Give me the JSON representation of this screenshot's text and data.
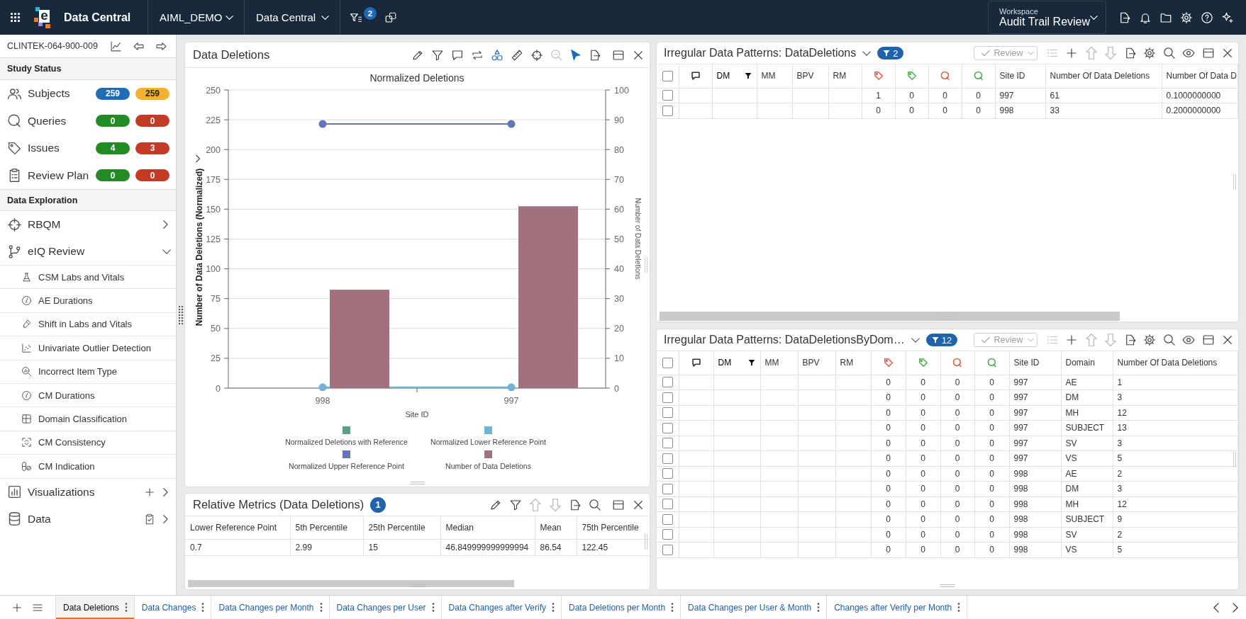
{
  "top_bar": {
    "logo_mark": "e",
    "app_name": "Data Central",
    "selectors": [
      {
        "label": "AIML_DEMO"
      },
      {
        "label": "Data Central"
      }
    ],
    "filter_count": "2",
    "workspace": {
      "caption": "Workspace",
      "value": "Audit Trail Review"
    }
  },
  "sidebar": {
    "study_id": "CLINTEK-064-900-009",
    "study_status": {
      "title": "Study Status",
      "items": [
        {
          "label": "Subjects",
          "badges": [
            {
              "value": "259",
              "color": "#1f6cb5"
            },
            {
              "value": "259",
              "color": "#f2b22e"
            }
          ]
        },
        {
          "label": "Queries",
          "badges": [
            {
              "value": "0",
              "color": "#238b23"
            },
            {
              "value": "0",
              "color": "#c33b25"
            }
          ]
        },
        {
          "label": "Issues",
          "badges": [
            {
              "value": "4",
              "color": "#238b23"
            },
            {
              "value": "3",
              "color": "#c33b25"
            }
          ]
        },
        {
          "label": "Review Plan",
          "badges": [
            {
              "value": "0",
              "color": "#238b23"
            },
            {
              "value": "0",
              "color": "#c33b25"
            }
          ]
        }
      ]
    },
    "data_exploration": {
      "title": "Data Exploration",
      "items": [
        {
          "label": "RBQM",
          "expanded": false
        },
        {
          "label": "eIQ Review",
          "expanded": true,
          "children": [
            {
              "label": "CSM Labs and Vitals"
            },
            {
              "label": "AE Durations"
            },
            {
              "label": "Shift in Labs and Vitals"
            },
            {
              "label": "Univariate Outlier Detection"
            },
            {
              "label": "Incorrect Item Type"
            },
            {
              "label": "CM Durations"
            },
            {
              "label": "Domain Classification"
            },
            {
              "label": "CM Consistency"
            },
            {
              "label": "CM Indication"
            }
          ]
        },
        {
          "label": "Visualizations",
          "expanded": false
        },
        {
          "label": "Data",
          "expanded": false
        }
      ]
    }
  },
  "chart_panel": {
    "title": "Data Deletions",
    "tools": [
      {
        "disabled": false,
        "selected": false
      },
      {
        "disabled": false,
        "selected": false
      },
      {
        "disabled": false,
        "selected": false
      },
      {
        "disabled": false,
        "selected": false
      },
      {
        "disabled": false,
        "selected": false
      },
      {
        "disabled": false,
        "selected": false
      },
      {
        "disabled": false,
        "selected": false
      },
      {
        "disabled": true,
        "selected": false
      },
      {
        "disabled": false,
        "selected": true
      },
      {
        "disabled": false,
        "selected": false
      },
      {
        "disabled": false,
        "selected": false
      },
      {
        "disabled": false,
        "selected": false
      }
    ],
    "chart_data": {
      "type": "bar",
      "title": "Normalized Deletions",
      "xlabel": "Site ID",
      "ylabel": "Number of Data Deletions (Normalized)",
      "y2label": "Number of Data Deletions",
      "categories": [
        "998",
        "997"
      ],
      "ylim": [
        0,
        250
      ],
      "yticks": [
        0,
        25,
        50,
        75,
        100,
        125,
        150,
        175,
        200,
        225,
        250
      ],
      "y2lim": [
        0,
        100
      ],
      "y2ticks": [
        0,
        10,
        20,
        30,
        40,
        50,
        60,
        70,
        80,
        90,
        100
      ],
      "grid": true,
      "legend": "bottom",
      "series": [
        {
          "name": "Normalized Deletions with Reference",
          "color": "#5a9e8e",
          "type": "bar",
          "values": [
            null,
            null
          ]
        },
        {
          "name": "Normalized Lower Reference Point",
          "color": "#6db3da",
          "type": "line",
          "marker": "circle",
          "values": [
            0.7,
            0.7
          ]
        },
        {
          "name": "Normalized Upper Reference Point",
          "color": "#6474b5",
          "type": "line",
          "marker": "circle",
          "values": [
            221.5,
            221.5
          ]
        },
        {
          "name": "Number of Data Deletions",
          "color": "#a3707e",
          "type": "bar",
          "axis": "y2",
          "values": [
            33,
            61
          ]
        }
      ]
    }
  },
  "metrics_panel": {
    "title": "Relative Metrics (Data Deletions)",
    "count": "1",
    "tools": [
      {
        "disabled": false
      },
      {
        "disabled": false
      },
      {
        "disabled": true
      },
      {
        "disabled": true
      },
      {
        "disabled": false
      },
      {
        "disabled": false
      },
      {
        "disabled": false
      },
      {
        "disabled": false
      }
    ],
    "columns": [
      "Lower Reference Point",
      "5th Percentile",
      "25th Percentile",
      "Median",
      "Mean",
      "75th Percentile"
    ],
    "rows": [
      [
        "0.7",
        "2.99",
        "15",
        "46.849999999999994",
        "86.54",
        "122.45"
      ]
    ]
  },
  "patterns_panels": [
    {
      "title": "Irregular Data Patterns: DataDeletions",
      "filter_count": "2",
      "review": {
        "label": "Review",
        "disabled": true
      },
      "tools": [
        {
          "disabled": true
        },
        {
          "disabled": false
        },
        {
          "disabled": true
        },
        {
          "disabled": true
        },
        {
          "disabled": false
        },
        {
          "disabled": false
        },
        {
          "disabled": false
        },
        {
          "disabled": false
        },
        {
          "disabled": false
        },
        {
          "disabled": false
        }
      ],
      "select_all": {
        "checked": false
      },
      "columns": [
        {
          "kind": "comment",
          "filtered": false
        },
        {
          "kind": "text",
          "label": "DM",
          "filtered": true
        },
        {
          "kind": "text",
          "label": "MM",
          "filtered": false
        },
        {
          "kind": "text",
          "label": "BPV",
          "filtered": false
        },
        {
          "kind": "text",
          "label": "RM",
          "filtered": false
        },
        {
          "kind": "tag",
          "color": "#e0604c",
          "filtered": false
        },
        {
          "kind": "tag",
          "color": "#4caf50",
          "filtered": false
        },
        {
          "kind": "query",
          "color": "#e0604c",
          "filtered": false
        },
        {
          "kind": "query",
          "color": "#4caf50",
          "filtered": false
        },
        {
          "kind": "text",
          "label": "Site ID",
          "filtered": false
        },
        {
          "kind": "text",
          "label": "Number Of Data Deletions",
          "filtered": false
        },
        {
          "kind": "text",
          "label": "Number Of Data D",
          "filtered": false
        }
      ],
      "rows": [
        {
          "checked": false,
          "cells": [
            "1",
            "0",
            "0",
            "0",
            "997",
            "61",
            "0.1000000000"
          ]
        },
        {
          "checked": false,
          "cells": [
            "0",
            "0",
            "0",
            "0",
            "998",
            "33",
            "0.2000000000"
          ]
        }
      ]
    },
    {
      "title": "Irregular Data Patterns: DataDeletionsByDom…",
      "filter_count": "12",
      "review": {
        "label": "Review",
        "disabled": true
      },
      "tools": [
        {
          "disabled": true
        },
        {
          "disabled": false
        },
        {
          "disabled": true
        },
        {
          "disabled": true
        },
        {
          "disabled": false
        },
        {
          "disabled": false
        },
        {
          "disabled": false
        },
        {
          "disabled": false
        },
        {
          "disabled": false
        },
        {
          "disabled": false
        }
      ],
      "select_all": {
        "checked": false
      },
      "columns": [
        {
          "kind": "comment",
          "filtered": false
        },
        {
          "kind": "text",
          "label": "DM",
          "filtered": true
        },
        {
          "kind": "text",
          "label": "MM",
          "filtered": false
        },
        {
          "kind": "text",
          "label": "BPV",
          "filtered": false
        },
        {
          "kind": "text",
          "label": "RM",
          "filtered": false
        },
        {
          "kind": "tag",
          "color": "#e0604c",
          "filtered": false
        },
        {
          "kind": "tag",
          "color": "#4caf50",
          "filtered": false
        },
        {
          "kind": "query",
          "color": "#e0604c",
          "filtered": false
        },
        {
          "kind": "query",
          "color": "#4caf50",
          "filtered": false
        },
        {
          "kind": "text",
          "label": "Site ID",
          "filtered": false
        },
        {
          "kind": "text",
          "label": "Domain",
          "filtered": false
        },
        {
          "kind": "text",
          "label": "Number Of Data Deletions",
          "filtered": false
        }
      ],
      "rows": [
        {
          "checked": false,
          "cells": [
            "0",
            "0",
            "0",
            "0",
            "997",
            "AE",
            "1"
          ]
        },
        {
          "checked": false,
          "cells": [
            "0",
            "0",
            "0",
            "0",
            "997",
            "DM",
            "3"
          ]
        },
        {
          "checked": false,
          "cells": [
            "0",
            "0",
            "0",
            "0",
            "997",
            "MH",
            "12"
          ]
        },
        {
          "checked": false,
          "cells": [
            "0",
            "0",
            "0",
            "0",
            "997",
            "SUBJECT",
            "13"
          ]
        },
        {
          "checked": false,
          "cells": [
            "0",
            "0",
            "0",
            "0",
            "997",
            "SV",
            "3"
          ]
        },
        {
          "checked": false,
          "cells": [
            "0",
            "0",
            "0",
            "0",
            "997",
            "VS",
            "5"
          ]
        },
        {
          "checked": false,
          "cells": [
            "0",
            "0",
            "0",
            "0",
            "998",
            "AE",
            "2"
          ]
        },
        {
          "checked": false,
          "cells": [
            "0",
            "0",
            "0",
            "0",
            "998",
            "DM",
            "3"
          ]
        },
        {
          "checked": false,
          "cells": [
            "0",
            "0",
            "0",
            "0",
            "998",
            "MH",
            "12"
          ]
        },
        {
          "checked": false,
          "cells": [
            "0",
            "0",
            "0",
            "0",
            "998",
            "SUBJECT",
            "9"
          ]
        },
        {
          "checked": false,
          "cells": [
            "0",
            "0",
            "0",
            "0",
            "998",
            "SV",
            "2"
          ]
        },
        {
          "checked": false,
          "cells": [
            "0",
            "0",
            "0",
            "0",
            "998",
            "VS",
            "5"
          ]
        }
      ]
    }
  ],
  "tabs": [
    {
      "label": "Data Deletions",
      "selected": true
    },
    {
      "label": "Data Changes",
      "selected": false
    },
    {
      "label": "Data Changes per Month",
      "selected": false
    },
    {
      "label": "Data Changes per User",
      "selected": false
    },
    {
      "label": "Data Changes after Verify",
      "selected": false
    },
    {
      "label": "Data Deletions per Month",
      "selected": false
    },
    {
      "label": "Data Changes per User & Month",
      "selected": false
    },
    {
      "label": "Changes after Verify per Month",
      "selected": false
    }
  ]
}
